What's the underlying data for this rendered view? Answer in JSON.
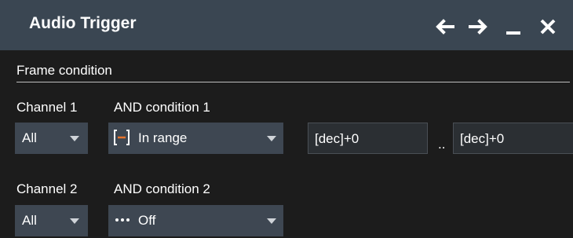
{
  "window": {
    "title": "Audio Trigger",
    "buttons": {
      "back": "back-arrow-icon",
      "forward": "forward-arrow-icon",
      "minimize": "minimize-icon",
      "close": "close-icon"
    }
  },
  "section": {
    "title": "Frame condition"
  },
  "rows": [
    {
      "channel_label": "Channel 1",
      "channel_value": "All",
      "condition_label": "AND condition 1",
      "condition_value": "In range",
      "condition_icon": "range-bracket-icon",
      "min_value": "[dec]+0",
      "range_separator": "..",
      "max_value": "[dec]+0"
    },
    {
      "channel_label": "Channel 2",
      "channel_value": "All",
      "condition_label": "AND condition 2",
      "condition_value": "Off",
      "condition_icon": "dots-icon"
    }
  ],
  "colors": {
    "titlebar": "#3a4652",
    "background": "#1c1c1c",
    "dropdown": "#3e4752",
    "accent": "#e8742c"
  }
}
